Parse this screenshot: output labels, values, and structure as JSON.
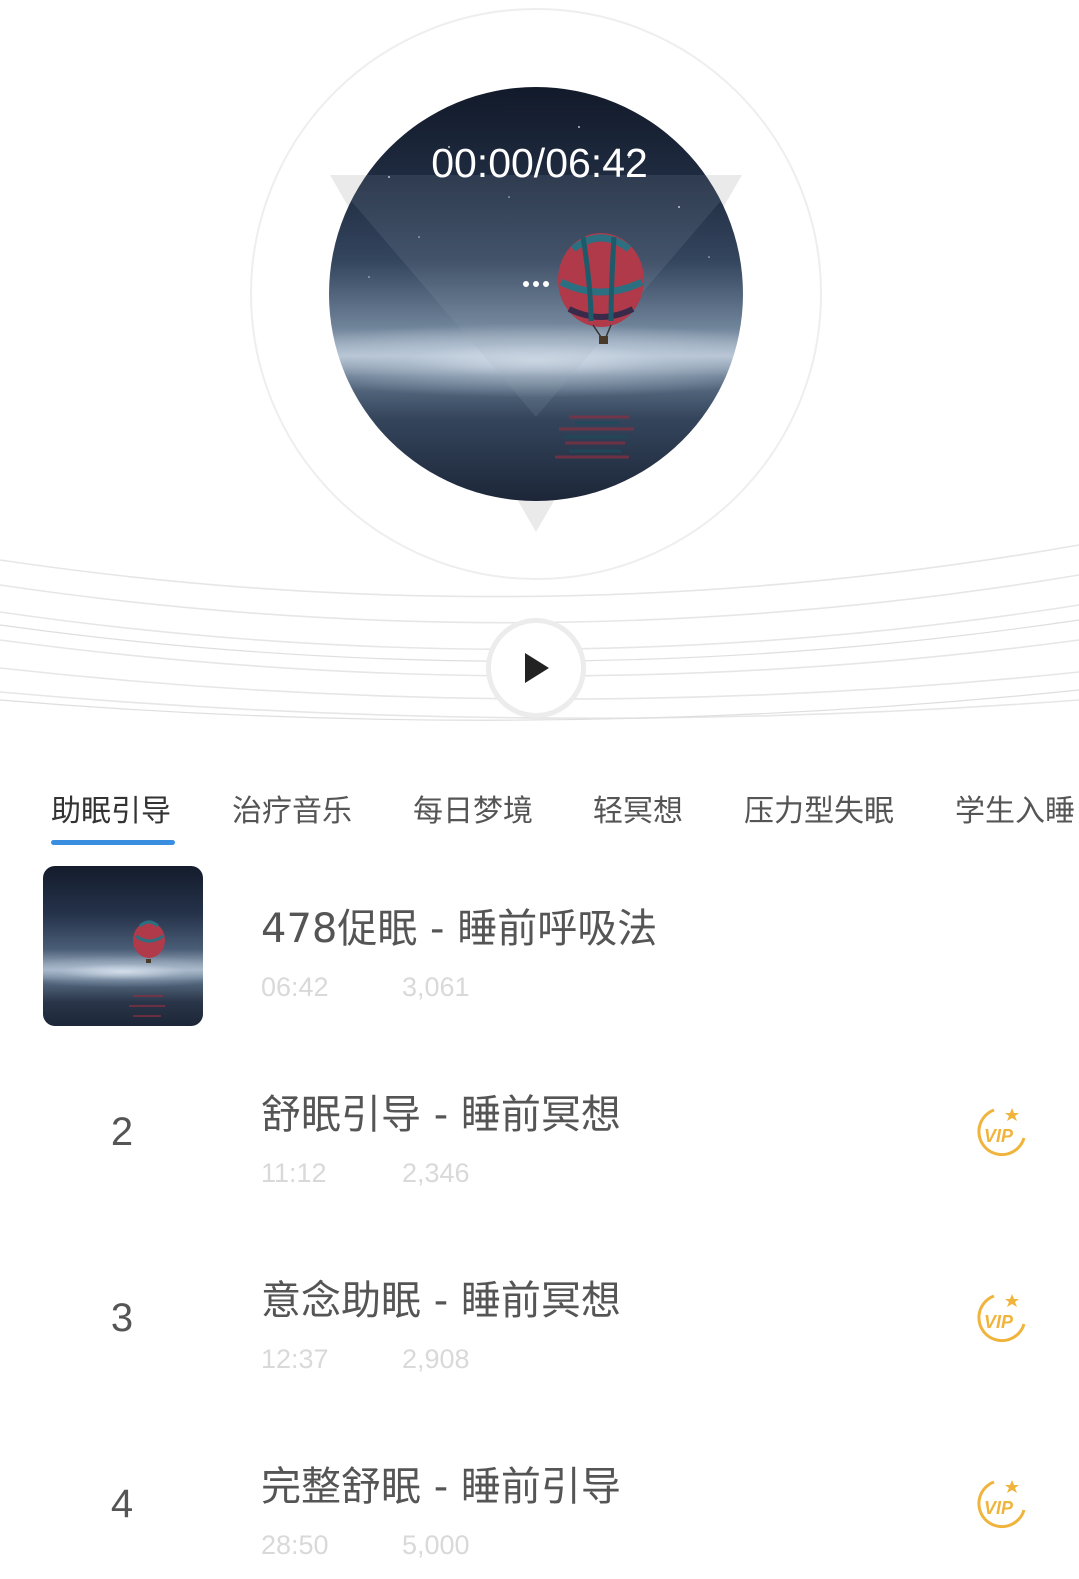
{
  "player": {
    "time_display": "00:00/06:42"
  },
  "tabs": [
    {
      "label": "助眠引导"
    },
    {
      "label": "治疗音乐"
    },
    {
      "label": "每日梦境"
    },
    {
      "label": "轻冥想"
    },
    {
      "label": "压力型失眠"
    },
    {
      "label": "学生入睡"
    }
  ],
  "tracks": [
    {
      "rank": "",
      "title": "478促眠 - 睡前呼吸法",
      "duration": "06:42",
      "plays": "3,061",
      "vip": false
    },
    {
      "rank": "2",
      "title": "舒眠引导 - 睡前冥想",
      "duration": "11:12",
      "plays": "2,346",
      "vip": true
    },
    {
      "rank": "3",
      "title": "意念助眠 - 睡前冥想",
      "duration": "12:37",
      "plays": "2,908",
      "vip": true
    },
    {
      "rank": "4",
      "title": "完整舒眠 - 睡前引导",
      "duration": "28:50",
      "plays": "5,000",
      "vip": true
    }
  ],
  "colors": {
    "tab_active_underline": "#3a8ee0",
    "vip_gold": "#f0b43c",
    "text_primary": "#555555",
    "text_meta": "#d9d9d9"
  },
  "icons": {
    "play": "play-icon",
    "more": "more-dots-icon",
    "vip": "vip-badge-icon"
  }
}
